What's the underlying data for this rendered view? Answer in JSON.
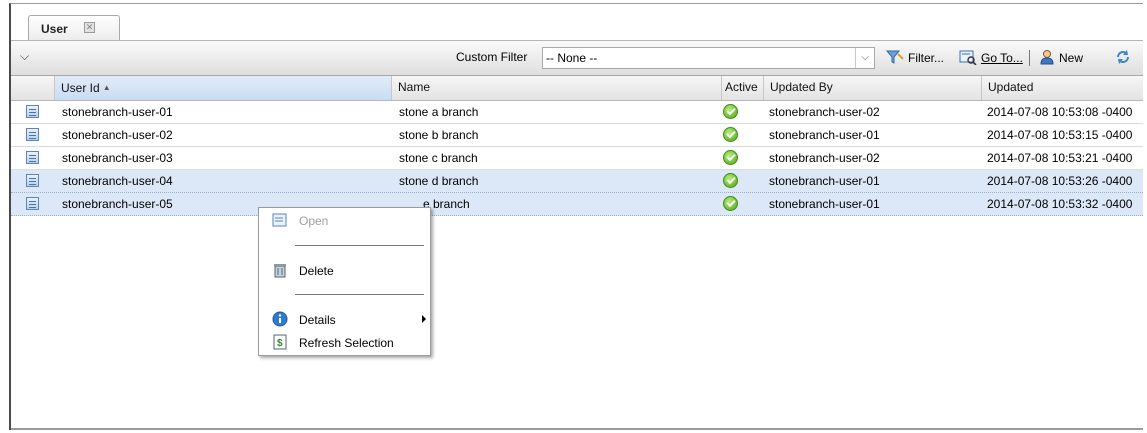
{
  "tab": {
    "label": "User",
    "close_icon": "close-icon"
  },
  "toolbar": {
    "collapse_icon": "chevron-down-icon",
    "custom_filter_label": "Custom Filter",
    "custom_filter_value": "-- None --",
    "filter_label": "Filter...",
    "goto_label": "Go To...",
    "new_label": "New",
    "refresh_icon": "refresh-icon"
  },
  "table": {
    "columns": [
      "User Id",
      "Name",
      "Active",
      "Updated By",
      "Updated"
    ],
    "sorted_column": "User Id",
    "rows": [
      {
        "user_id": "stonebranch-user-01",
        "name": "stone a branch",
        "active": true,
        "updated_by": "stonebranch-user-02",
        "updated": "2014-07-08 10:53:08 -0400",
        "selected": false
      },
      {
        "user_id": "stonebranch-user-02",
        "name": "stone b branch",
        "active": true,
        "updated_by": "stonebranch-user-01",
        "updated": "2014-07-08 10:53:15 -0400",
        "selected": false
      },
      {
        "user_id": "stonebranch-user-03",
        "name": "stone c branch",
        "active": true,
        "updated_by": "stonebranch-user-02",
        "updated": "2014-07-08 10:53:21 -0400",
        "selected": false
      },
      {
        "user_id": "stonebranch-user-04",
        "name": "stone d branch",
        "active": true,
        "updated_by": "stonebranch-user-01",
        "updated": "2014-07-08 10:53:26 -0400",
        "selected": true
      },
      {
        "user_id": "stonebranch-user-05",
        "name": "e branch",
        "active": true,
        "updated_by": "stonebranch-user-01",
        "updated": "2014-07-08 10:53:32 -0400",
        "selected": true
      }
    ]
  },
  "context_menu": {
    "open": "Open",
    "delete": "Delete",
    "details": "Details",
    "refresh_selection": "Refresh Selection"
  },
  "colors": {
    "selected_row": "#dce8f8",
    "active_check": "#4ea516"
  }
}
